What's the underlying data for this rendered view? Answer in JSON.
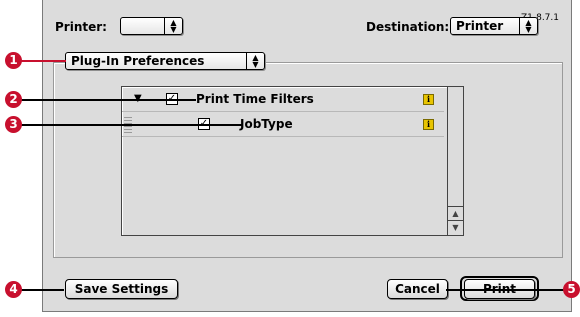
{
  "version": "Z1-8.7.1",
  "header": {
    "printer_label": "Printer:",
    "printer_value": "",
    "destination_label": "Destination:",
    "destination_value": "Printer"
  },
  "section_popup": {
    "value": "Plug-In Preferences"
  },
  "list": {
    "items": [
      {
        "label": "Print Time Filters",
        "checked": true,
        "expandable": true,
        "expanded": true,
        "info_icon": "i"
      },
      {
        "label": "JobType",
        "checked": true,
        "expandable": false,
        "info_icon": "i"
      }
    ]
  },
  "buttons": {
    "save_settings": "Save Settings",
    "cancel": "Cancel",
    "print": "Print"
  },
  "callouts": [
    "1",
    "2",
    "3",
    "4",
    "5"
  ],
  "icons": {
    "popup_arrows": "▲▼",
    "check": "✓",
    "disclosure": "▼",
    "scroll_up": "▲",
    "scroll_down": "▼"
  },
  "colors": {
    "callout": "#c8102e",
    "dialog_bg": "#dcdcdc"
  }
}
